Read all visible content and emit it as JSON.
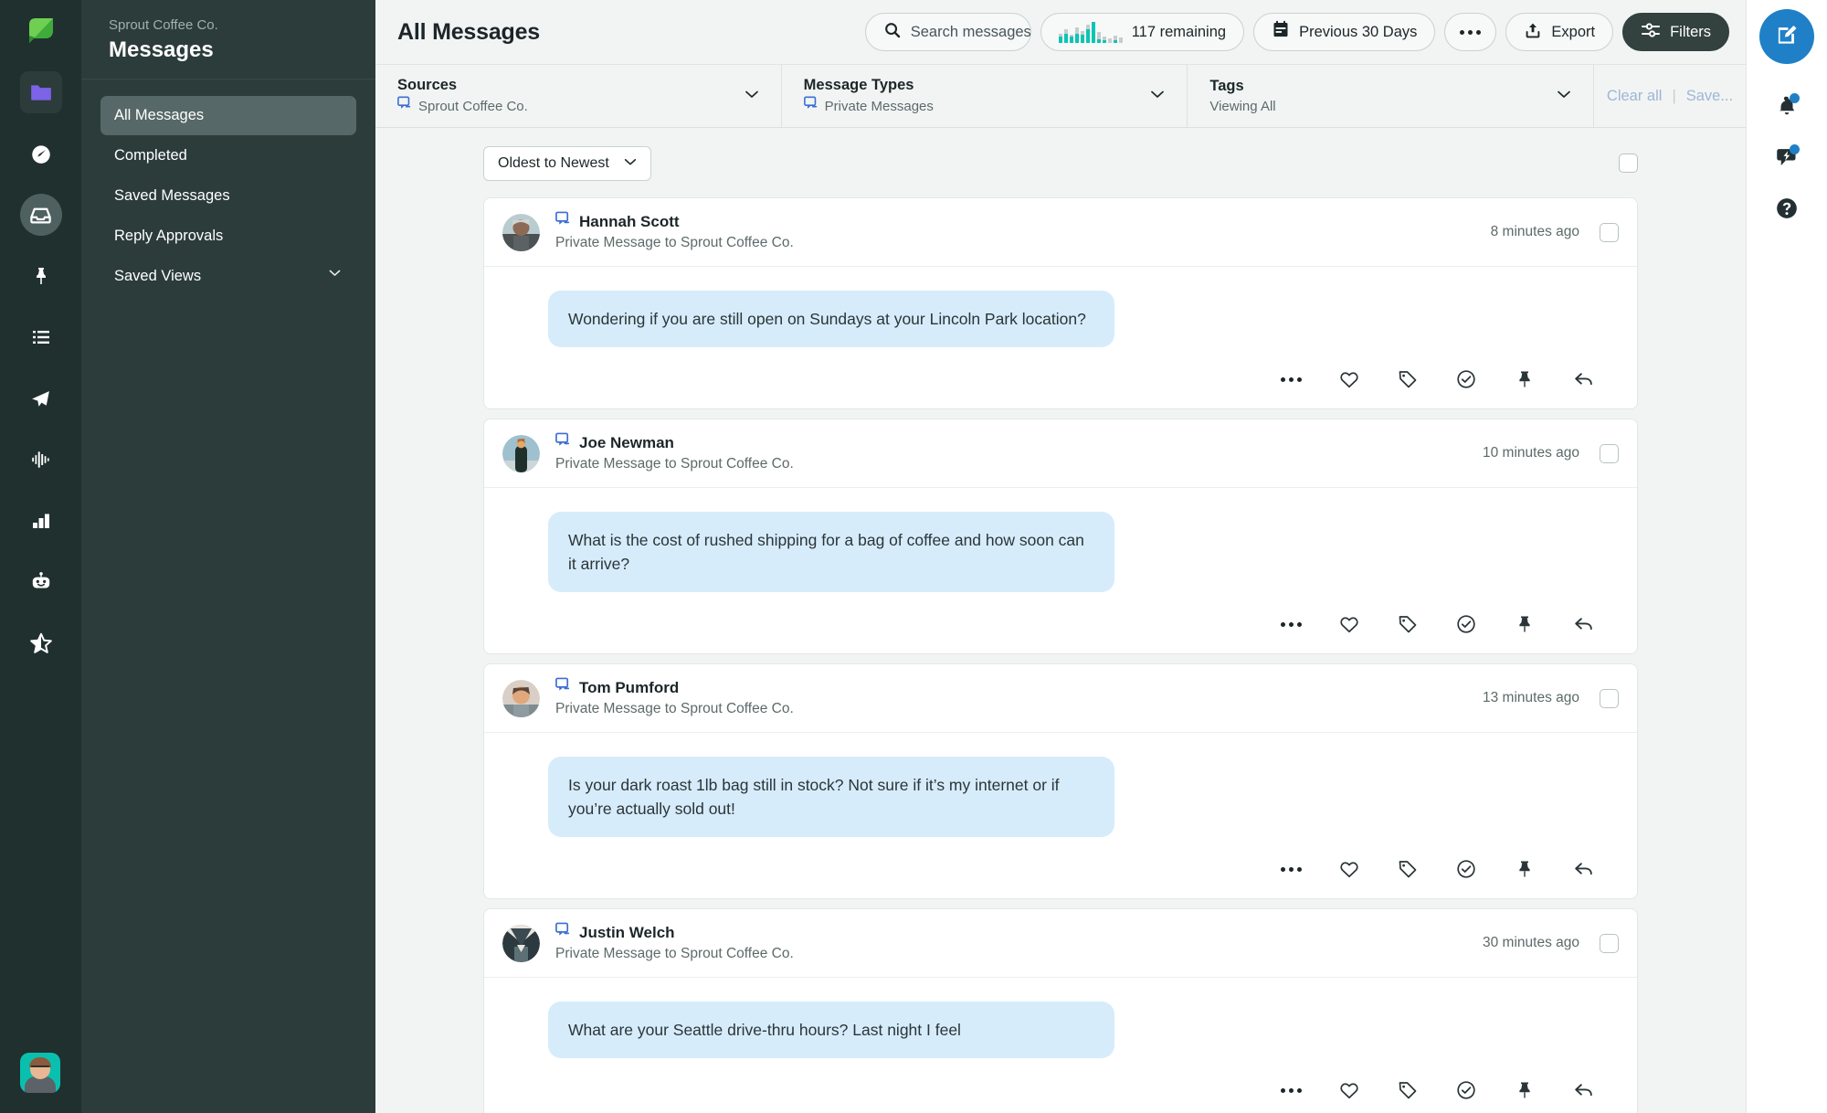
{
  "left_rail": {
    "logo": "sprout-leaf-logo",
    "items": [
      {
        "name": "publishing-folder",
        "icon": "folder-icon",
        "state": "inactive-box"
      },
      {
        "name": "dashboard",
        "icon": "speedometer-icon",
        "state": "inactive"
      },
      {
        "name": "smart-inbox",
        "icon": "inbox-icon",
        "state": "active"
      },
      {
        "name": "pinned",
        "icon": "pin-icon",
        "state": "inactive"
      },
      {
        "name": "tasks",
        "icon": "list-icon",
        "state": "inactive"
      },
      {
        "name": "publish",
        "icon": "paper-plane-icon",
        "state": "inactive"
      },
      {
        "name": "listening",
        "icon": "soundwave-icon",
        "state": "inactive"
      },
      {
        "name": "reports",
        "icon": "bar-chart-icon",
        "state": "inactive"
      },
      {
        "name": "bots",
        "icon": "robot-icon",
        "state": "inactive"
      },
      {
        "name": "reviews",
        "icon": "half-star-icon",
        "state": "inactive"
      }
    ],
    "user_avatar": "user-avatar"
  },
  "sidebar": {
    "org": "Sprout Coffee Co.",
    "title": "Messages",
    "items": [
      {
        "label": "All Messages",
        "selected": true,
        "expandable": false
      },
      {
        "label": "Completed",
        "selected": false,
        "expandable": false
      },
      {
        "label": "Saved Messages",
        "selected": false,
        "expandable": false
      },
      {
        "label": "Reply Approvals",
        "selected": false,
        "expandable": false
      },
      {
        "label": "Saved Views",
        "selected": false,
        "expandable": true
      }
    ]
  },
  "header": {
    "title": "All Messages",
    "search_placeholder": "Search messages",
    "remaining_label": "117 remaining",
    "date_range_label": "Previous 30 Days",
    "more_label": "More options",
    "export_label": "Export",
    "filters_label": "Filters"
  },
  "filters": {
    "sources": {
      "label": "Sources",
      "value": "Sprout Coffee Co.",
      "icon": "messenger-icon"
    },
    "message_types": {
      "label": "Message Types",
      "value": "Private Messages",
      "icon": "messenger-icon"
    },
    "tags": {
      "label": "Tags",
      "value": "Viewing All",
      "icon": ""
    },
    "clear_all": "Clear all",
    "separator": "|",
    "save": "Save..."
  },
  "feed": {
    "sort_label": "Oldest to Newest",
    "select_all_checkbox": "select-all",
    "action_icons": [
      "ellipsis-icon",
      "heart-icon",
      "tag-icon",
      "check-circle-icon",
      "pin-icon",
      "reply-icon"
    ],
    "messages": [
      {
        "author": "Hannah Scott",
        "subtitle": "Private Message to Sprout Coffee Co.",
        "timestamp": "8 minutes ago",
        "text": "Wondering if you are still open on Sundays at your Lincoln Park location?",
        "network_icon": "messenger-icon"
      },
      {
        "author": "Joe Newman",
        "subtitle": "Private Message to Sprout Coffee Co.",
        "timestamp": "10 minutes ago",
        "text": "What is the cost of rushed shipping for a bag of coffee and how soon can it arrive?",
        "network_icon": "messenger-icon"
      },
      {
        "author": "Tom Pumford",
        "subtitle": "Private Message to Sprout Coffee Co.",
        "timestamp": "13 minutes ago",
        "text": "Is your dark roast 1lb bag still in stock? Not sure if it’s my internet or if you’re actually sold out!",
        "network_icon": "messenger-icon"
      },
      {
        "author": "Justin Welch",
        "subtitle": "Private Message to Sprout Coffee Co.",
        "timestamp": "30 minutes ago",
        "text": "What are your Seattle drive-thru hours? Last night I feel",
        "network_icon": "messenger-icon"
      }
    ]
  },
  "right_rail": {
    "compose": "compose-button",
    "notifications": "bell-icon",
    "whats_new": "announcement-icon",
    "help": "help-icon"
  },
  "colors": {
    "brand_green": "#59ba47",
    "nav_dark": "#2c3c3b",
    "rail_dark": "#20302f",
    "accent_blue": "#1f80c7",
    "bubble_blue": "#d7ecfb",
    "filters_dark": "#33413f",
    "link_blue": "#9db6d5",
    "spark_teal": "#0bc5b4"
  }
}
